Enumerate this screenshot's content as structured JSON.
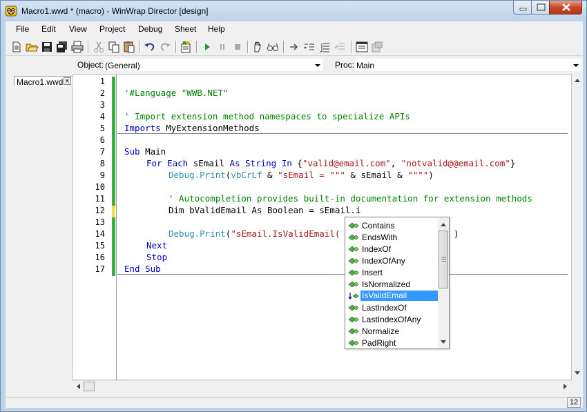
{
  "window": {
    "title": "Macro1.wwd * (macro) - WinWrap Director [design]"
  },
  "menu": [
    "File",
    "Edit",
    "View",
    "Project",
    "Debug",
    "Sheet",
    "Help"
  ],
  "objbar": {
    "object_label": "Object:",
    "object_value": "(General)",
    "proc_label": "Proc:",
    "proc_value": "Main"
  },
  "doc_tab": {
    "label": "Macro1.wwd *"
  },
  "editor": {
    "line_numbers": [
      "1",
      "2",
      "3",
      "4",
      "5",
      "6",
      "7",
      "8",
      "9",
      "10",
      "11",
      "12",
      "13",
      "14",
      "15",
      "16",
      "17"
    ],
    "l2": "'#Language \"WWB.NET\"",
    "l4": "' Import extension method namespaces to specialize APIs",
    "l5_kw": "Imports",
    "l5_rest": " MyExtensionMethods",
    "l7_kw": "Sub",
    "l7_rest": " Main",
    "l8_a": "For Each",
    "l8_b": " sEmail ",
    "l8_c": "As String In",
    "l8_d": " {",
    "l8_e": "\"valid@email.com\"",
    "l8_f": ", ",
    "l8_g": "\"notvalid@@email.com\"",
    "l8_h": "}",
    "l9_a": "Debug.",
    "l9_b": "Print",
    "l9_c": "(",
    "l9_d": "vbCrLf",
    "l9_e": " & ",
    "l9_f": "\"sEmail = \"\"\"",
    "l9_g": " & sEmail & ",
    "l9_h": "\"\"\"\"",
    "l9_i": ")",
    "l11": "' Autocompletion provides built-in documentation for extension methods",
    "l12_a": "Dim",
    "l12_b": " bValidEmail ",
    "l12_c": "As Boolean",
    "l12_d": " = sEmail.i",
    "l14_a": "Debug.",
    "l14_b": "Print",
    "l14_c": "(",
    "l14_d": "\"sEmail.IsValidEmail(",
    "l14_e": ")",
    "l15": "Next",
    "l16": "Stop",
    "l17": "End Sub"
  },
  "autocomplete": {
    "items": [
      "Contains",
      "EndsWith",
      "IndexOf",
      "IndexOfAny",
      "Insert",
      "IsNormalized",
      "IsValidEmail",
      "LastIndexOf",
      "LastIndexOfAny",
      "Normalize",
      "PadRight"
    ],
    "selected": "IsValidEmail"
  },
  "status": {
    "line": "12"
  },
  "colors": {
    "keyword": "#0000c0",
    "comment": "#008000",
    "string": "#a31515",
    "selection": "#3399ff",
    "change_bar": "#3cb043"
  }
}
